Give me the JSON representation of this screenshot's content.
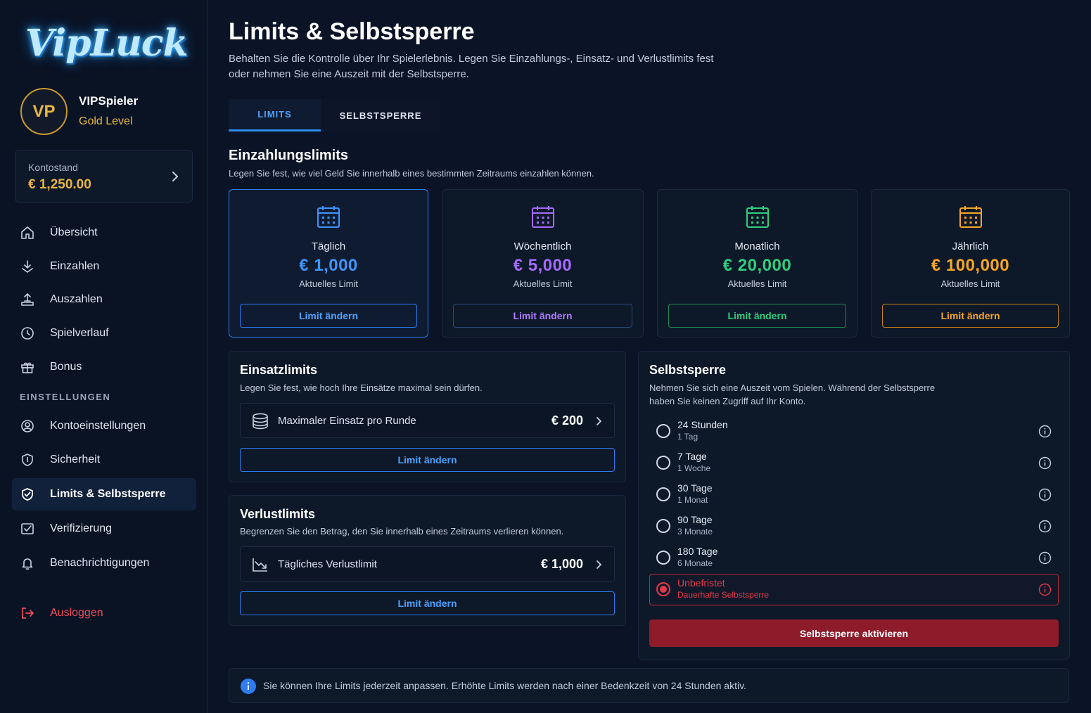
{
  "brand": {
    "logo_text": "VipLuck"
  },
  "user": {
    "initials": "VP",
    "name": "VIPSpieler",
    "level": "Gold Level"
  },
  "balance": {
    "label": "Kontostand",
    "value": "€ 1,250.00"
  },
  "nav": {
    "items": [
      {
        "label": "Übersicht",
        "icon": "home-icon"
      },
      {
        "label": "Einzahlen",
        "icon": "deposit-icon"
      },
      {
        "label": "Auszahlen",
        "icon": "withdraw-icon"
      },
      {
        "label": "Spielverlauf",
        "icon": "history-icon"
      },
      {
        "label": "Bonus",
        "icon": "gift-icon"
      }
    ],
    "section_label": "EINSTELLUNGEN",
    "settings": [
      {
        "label": "Kontoeinstellungen",
        "icon": "user-settings-icon"
      },
      {
        "label": "Sicherheit",
        "icon": "shield-icon"
      },
      {
        "label": "Limits & Selbstsperre",
        "icon": "shield-check-icon"
      },
      {
        "label": "Verifizierung",
        "icon": "verify-icon"
      },
      {
        "label": "Benachrichtigungen",
        "icon": "bell-icon"
      }
    ],
    "logout": "Ausloggen"
  },
  "page": {
    "title": "Limits & Selbstsperre",
    "description": "Behalten Sie die Kontrolle über Ihr Spielerlebnis. Legen Sie Einzahlungs-, Einsatz- und Verlustlimits fest oder nehmen Sie eine Auszeit mit der Selbstsperre.",
    "tabs": [
      {
        "label": "LIMITS"
      },
      {
        "label": "SELBSTSPERRE"
      }
    ]
  },
  "deposit": {
    "title": "Einzahlungslimits",
    "description": "Legen Sie fest, wie viel Geld Sie innerhalb eines bestimmten Zeitraums einzahlen können.",
    "cards": [
      {
        "label": "Täglich",
        "value": "€ 1,000",
        "sub": "Aktuelles Limit",
        "button": "Limit ändern",
        "color": "#3d95ff"
      },
      {
        "label": "Wöchentlich",
        "value": "€ 5,000",
        "sub": "Aktuelles Limit",
        "button": "Limit ändern",
        "color": "#a66bff"
      },
      {
        "label": "Monatlich",
        "value": "€ 20,000",
        "sub": "Aktuelles Limit",
        "button": "Limit ändern",
        "color": "#2fcf7d"
      },
      {
        "label": "Jährlich",
        "value": "€ 100,000",
        "sub": "Aktuelles Limit",
        "button": "Limit ändern",
        "color": "#f5a623"
      }
    ]
  },
  "stake": {
    "title": "Einsatzlimits",
    "description": "Legen Sie fest, wie hoch Ihre Einsätze maximal sein dürfen.",
    "row_label": "Maximaler Einsatz pro Runde",
    "row_value": "€ 200",
    "button": "Limit ändern"
  },
  "loss": {
    "title": "Verlustlimits",
    "description": "Begrenzen Sie den Betrag, den Sie innerhalb eines Zeitraums verlieren können.",
    "row_label": "Tägliches Verlustlimit",
    "row_value": "€ 1,000",
    "button": "Limit ändern"
  },
  "selfexclusion": {
    "title": "Selbstsperre",
    "description": "Nehmen Sie sich eine Auszeit vom Spielen. Während der Selbstsperre haben Sie keinen Zugriff auf Ihr Konto.",
    "options": [
      {
        "title": "24 Stunden",
        "sub": "1 Tag"
      },
      {
        "title": "7 Tage",
        "sub": "1 Woche"
      },
      {
        "title": "30 Tage",
        "sub": "1 Monat"
      },
      {
        "title": "90 Tage",
        "sub": "3 Monate"
      },
      {
        "title": "180 Tage",
        "sub": "6 Monate"
      },
      {
        "title": "Unbefristet",
        "sub": "Dauerhafte Selbstsperre"
      }
    ],
    "selected_index": 5,
    "button": "Selbstsperre aktivieren"
  },
  "notice": {
    "text": "Sie können Ihre Limits jederzeit anpassen. Erhöhte Limits werden nach einer Bedenkzeit von 24 Stunden aktiv."
  },
  "colors": {
    "accent": "#2d8cf0",
    "gold": "#e9b640",
    "danger": "#e23a4c",
    "background": "#0b1426"
  }
}
